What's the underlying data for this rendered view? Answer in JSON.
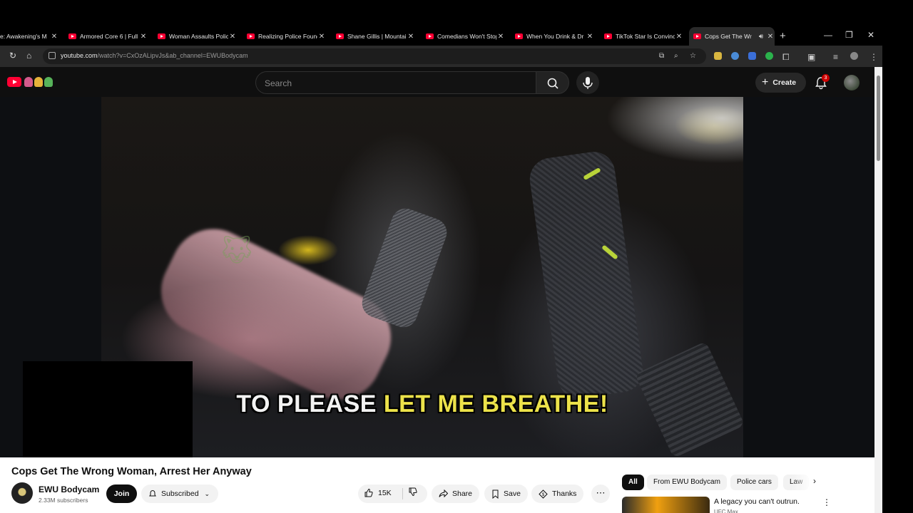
{
  "browser": {
    "tabs": [
      {
        "title": "e: Awakening's M",
        "active": false
      },
      {
        "title": "Armored Core 6 | Full",
        "active": false
      },
      {
        "title": "Woman Assaults Polic",
        "active": false
      },
      {
        "title": "Realizing Police Found",
        "active": false
      },
      {
        "title": "Shane Gillis | Mountai",
        "active": false
      },
      {
        "title": "Comedians Won't Stop",
        "active": false
      },
      {
        "title": "When You Drink & Dr",
        "active": false
      },
      {
        "title": "TikTok Star Is Convinc",
        "active": false
      },
      {
        "title": "Cops Get The Wr",
        "active": true
      }
    ],
    "url_host": "youtube.com",
    "url_path": "/watch?v=CxOzALipvJs&ab_channel=EWUBodycam",
    "icons": {
      "back": "reload-icon",
      "home": "home-icon"
    }
  },
  "header": {
    "search_placeholder": "Search",
    "create_label": "Create",
    "notification_count": "3"
  },
  "video": {
    "caption_white": "TO PLEASE",
    "caption_yellow": "LET ME BREATHE!",
    "title": "Cops Get The Wrong Woman, Arrest Her Anyway"
  },
  "channel": {
    "name": "EWU Bodycam",
    "subscribers": "2.33M subscribers",
    "join_label": "Join",
    "subscribed_label": "Subscribed"
  },
  "actions": {
    "likes": "15K",
    "share_label": "Share",
    "save_label": "Save",
    "thanks_label": "Thanks"
  },
  "chips": [
    "All",
    "From EWU Bodycam",
    "Police cars",
    "Law"
  ],
  "recommendation": {
    "title": "A legacy you can't outrun.",
    "subtitle": "UFC Max"
  },
  "colors": {
    "youtube_red": "#ff0033",
    "caption_yellow": "#ece24a",
    "page_dark": "#0f0f0f"
  }
}
